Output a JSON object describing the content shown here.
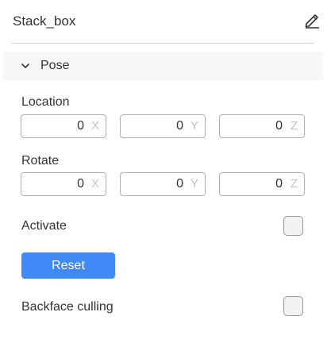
{
  "object": {
    "name": "Stack_box"
  },
  "pose": {
    "title": "Pose",
    "location": {
      "label": "Location",
      "x": "0",
      "y": "0",
      "z": "0",
      "x_axis": "X",
      "y_axis": "Y",
      "z_axis": "Z"
    },
    "rotate": {
      "label": "Rotate",
      "x": "0",
      "y": "0",
      "z": "0",
      "x_axis": "X",
      "y_axis": "Y",
      "z_axis": "Z"
    }
  },
  "activate": {
    "label": "Activate",
    "checked": false
  },
  "reset": {
    "label": "Reset"
  },
  "backface_culling": {
    "label": "Backface culling",
    "checked": false
  },
  "colors": {
    "accent": "#3f8af7",
    "section_bg": "#f7f7f7",
    "border": "#b3b3b3"
  },
  "icons": {
    "edit": "pencil-icon",
    "collapse": "chevron-down-icon"
  }
}
